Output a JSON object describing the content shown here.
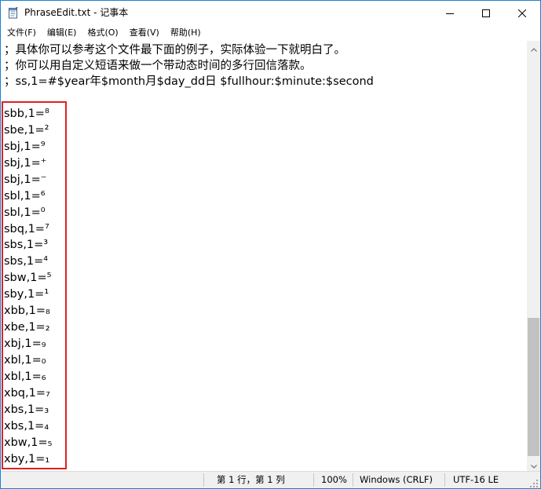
{
  "window": {
    "title": "PhraseEdit.txt - 记事本"
  },
  "menu": [
    {
      "label": "文件(F)"
    },
    {
      "label": "编辑(E)"
    },
    {
      "label": "格式(O)"
    },
    {
      "label": "查看(V)"
    },
    {
      "label": "帮助(H)"
    }
  ],
  "editor": {
    "lines": [
      "；具体你可以参考这个文件最下面的例子，实际体验一下就明白了。",
      "；你可以用自定义短语来做一个带动态时间的多行回信落款。",
      "；ss,1=#$year年$month月$day_dd日 $fullhour:$minute:$second",
      "",
      "sbb,1=⁸",
      "sbe,1=²",
      "sbj,1=⁹",
      "sbj,1=⁺",
      "sbj,1=⁻",
      "sbl,1=⁶",
      "sbl,1=⁰",
      "sbq,1=⁷",
      "sbs,1=³",
      "sbs,1=⁴",
      "sbw,1=⁵",
      "sby,1=¹",
      "xbb,1=₈",
      "xbe,1=₂",
      "xbj,1=₉",
      "xbl,1=₀",
      "xbl,1=₆",
      "xbq,1=₇",
      "xbs,1=₃",
      "xbs,1=₄",
      "xbw,1=₅",
      "xby,1=₁"
    ],
    "highlight_color": "#e02020"
  },
  "statusbar": {
    "position": "第 1 行，第 1 列",
    "zoom": "100%",
    "line_ending": "Windows (CRLF)",
    "encoding": "UTF-16 LE"
  },
  "icons": {
    "app": "notepad-icon",
    "minimize": "minimize-icon",
    "maximize": "maximize-icon",
    "close": "close-icon"
  },
  "colors": {
    "accent_border": "#1883d7",
    "statusbar_bg": "#f0f0f0",
    "scroll_thumb": "#c2c2c2"
  }
}
